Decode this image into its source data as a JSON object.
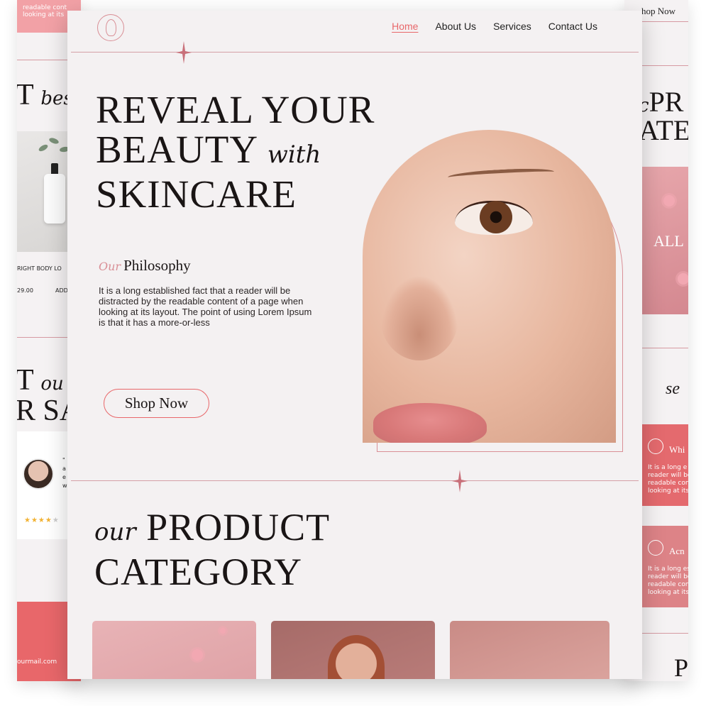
{
  "nav": {
    "links": [
      "Home",
      "About Us",
      "Services",
      "Contact Us"
    ],
    "active_index": 0
  },
  "hero": {
    "title_line1": "REVEAL YOUR",
    "title_line2": "BEAUTY",
    "title_line2_script": "with",
    "title_line3": "SKINCARE",
    "philosophy_prefix": "Our",
    "philosophy_heading": "Philosophy",
    "philosophy_text": "It is a long established fact that a reader will be distracted by the readable content of a page when looking at its layout. The point of using Lorem Ipsum is that it has a more-or-less",
    "cta_label": "Shop Now"
  },
  "category": {
    "prefix": "our",
    "title_line1": "PRODUCT",
    "title_line2": "CATEGORY"
  },
  "left_panel": {
    "top_text_1": "readable cont",
    "top_text_2": "looking at its",
    "big_text_1": "T",
    "big_text_1_script": "bes",
    "product_name": "RIGHT BODY LO",
    "price": "29.00",
    "add_label": "ADD",
    "big_text_2a": "T",
    "big_text_2a_script": "ou",
    "big_text_2b": "R SA",
    "review_text": "\"",
    "review_lines": [
      "a",
      "e",
      "w"
    ],
    "stars": "★★★★",
    "star_off": "★",
    "footer_email": "ourmail.com"
  },
  "right_panel": {
    "top_link": "hop Now",
    "big_text_1": "PR",
    "big_text_1_prefix": "c",
    "big_text_2": "ATE",
    "image_label": "ALL",
    "script_text": "se",
    "card1_title": "Whi",
    "card1_text": "It is a long e reader will be readable con looking at its",
    "card2_title": "Acn",
    "card2_text": "It is a long est reader will be readable cont looking at its l",
    "bottom_text": "P"
  },
  "colors": {
    "accent": "#e8676a",
    "accent_soft": "#d98f96",
    "background": "#f4f1f2",
    "text": "#1a1515",
    "card_red": "#e46a6e",
    "card_rose": "#dd8387"
  }
}
